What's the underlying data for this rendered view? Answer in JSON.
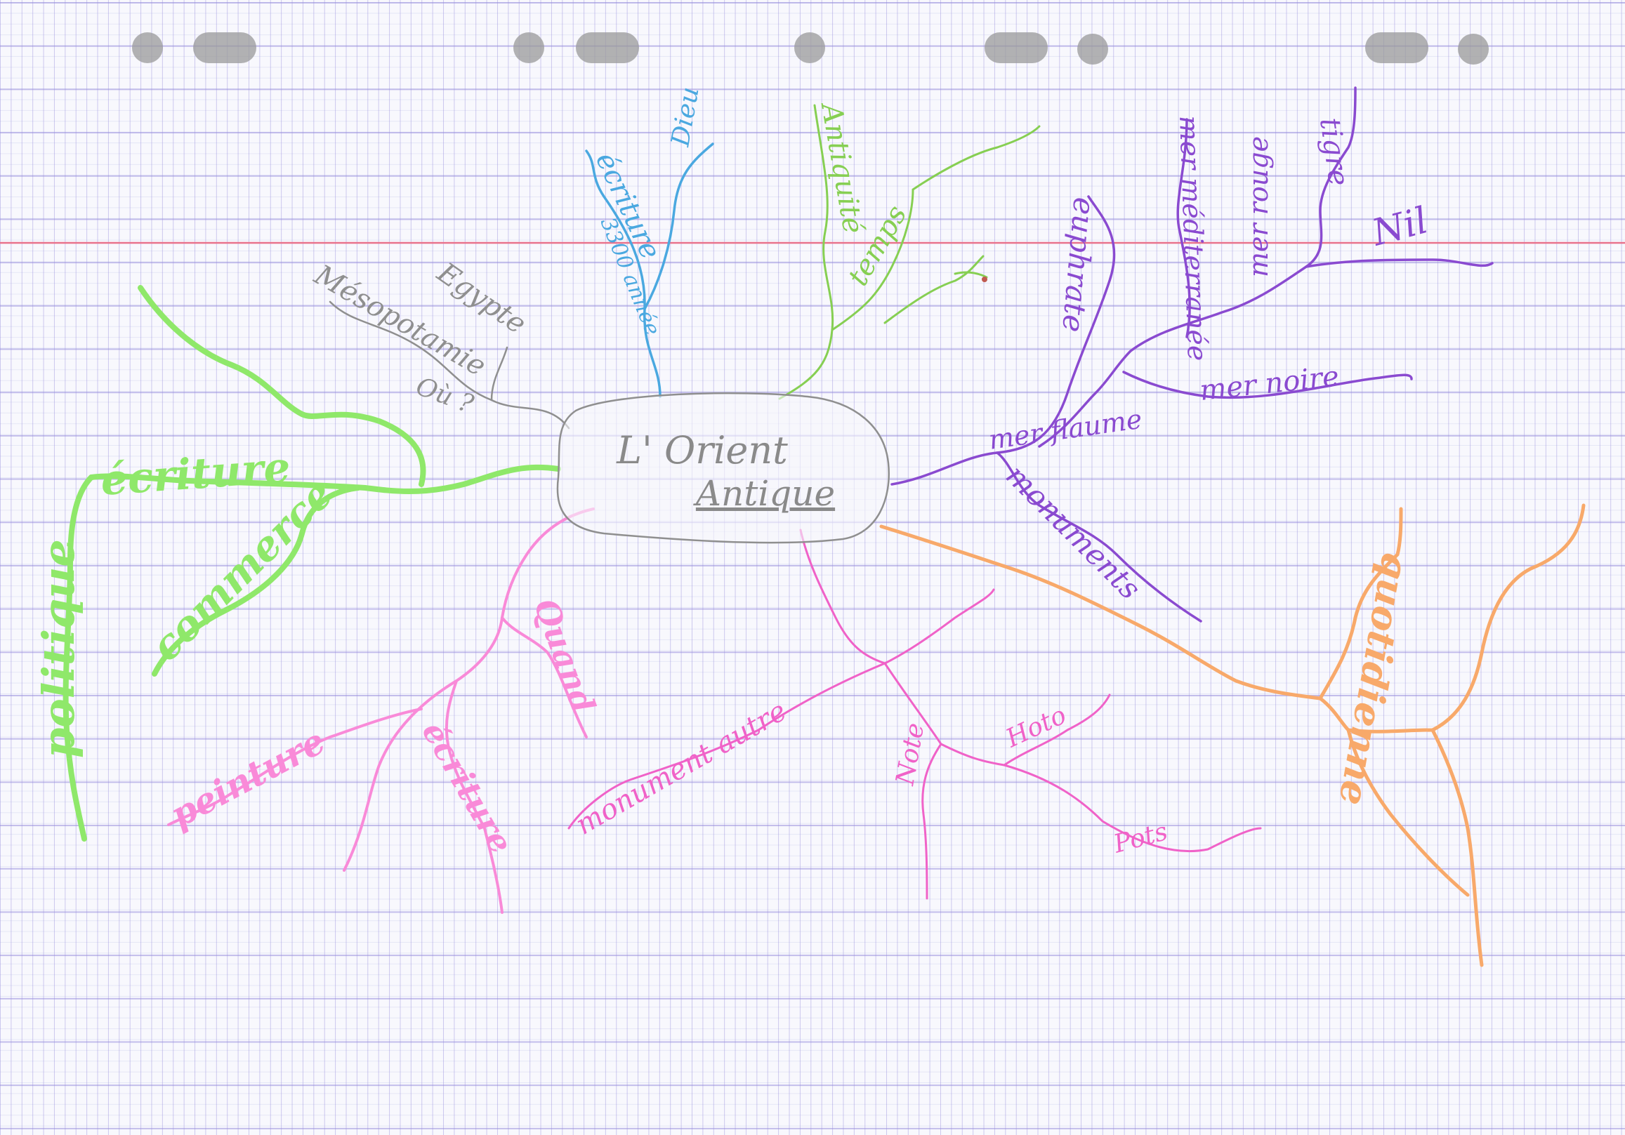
{
  "colors": {
    "paper": "#f8f8fd",
    "margin_line": "#e9728c",
    "pencil": "#8f8f8f",
    "green_light": "#8fe86a",
    "green_mid": "#86cf52",
    "blue": "#4aa8e0",
    "purple": "#8a4ad0",
    "pink": "#f062c8",
    "pink_light": "#f98ad8",
    "orange": "#f8a96a"
  },
  "mindmap": {
    "center": {
      "line1": "L' Orient",
      "line2": "Antique"
    },
    "labels": {
      "mesopotamie": "Mésopotamie",
      "egypte": "Egypte",
      "ou": "Où ?",
      "ecriture_blue": "écriture",
      "annee": "3300 année",
      "dieu": "Dieu",
      "antiquite": "Antiquité",
      "temps": "temps",
      "ecriture_left": "écriture",
      "politique": "politique",
      "commerce": "commerce",
      "mer_flaume": "mer flaume",
      "euphrate": "euphrate",
      "mer_mediterranee": "mer méditerranée",
      "tigre": "tigre",
      "nil": "Nil",
      "mer_rouge": "mer rouge",
      "mer_noire": "mer noire",
      "monuments": "monuments",
      "quotidienne": "quotidienne",
      "quand": "Quand",
      "ecriture_pink": "écriture",
      "peinture": "peinture",
      "monument_autre": "monument autre",
      "pink_right1": "Hoto",
      "pink_right2": "Note",
      "pink_right3": "Pots"
    }
  }
}
